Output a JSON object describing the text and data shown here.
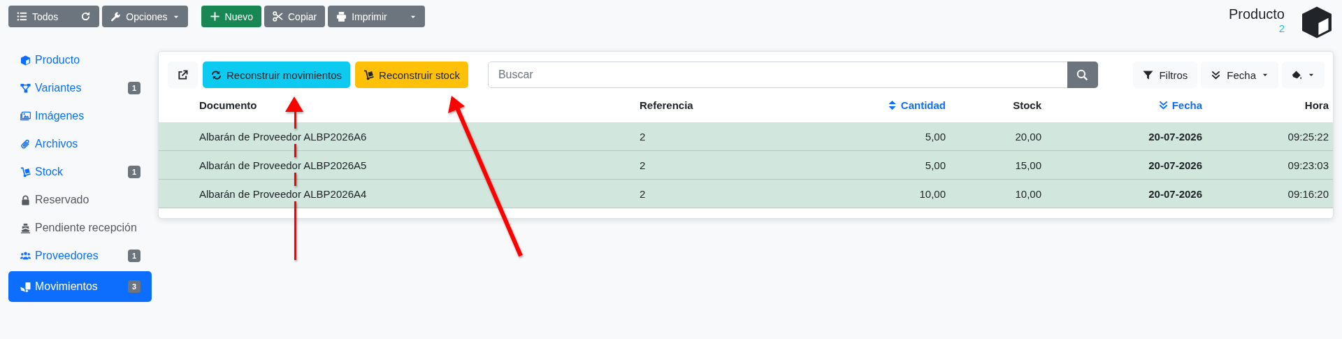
{
  "toolbar": {
    "groups": [
      {
        "buttons": [
          {
            "label": "Todos",
            "kind": "list"
          },
          {
            "label": "Opciones",
            "kind": "dropdown"
          }
        ]
      },
      {
        "buttons": [
          {
            "label": "Nuevo",
            "kind": "primary"
          },
          {
            "label": "Copiar",
            "kind": "plain"
          },
          {
            "label": "Imprimir",
            "kind": "split"
          }
        ]
      }
    ]
  },
  "header": {
    "title": "Producto",
    "count": "2"
  },
  "sidebar": {
    "items": [
      {
        "label": "Producto",
        "selected": false,
        "disabled": false
      },
      {
        "label": "Variantes",
        "badge": "1",
        "selected": false,
        "disabled": false
      },
      {
        "label": "Imágenes",
        "selected": false,
        "disabled": false
      },
      {
        "label": "Archivos",
        "selected": false,
        "disabled": false
      },
      {
        "label": "Stock",
        "badge": "1",
        "selected": false,
        "disabled": false
      },
      {
        "label": "Reservado",
        "selected": false,
        "disabled": true
      },
      {
        "label": "Pendiente recepción",
        "selected": false,
        "disabled": true
      },
      {
        "label": "Proveedores",
        "badge": "1",
        "selected": false,
        "disabled": false
      },
      {
        "label": "Movimientos",
        "badge": "3",
        "selected": true,
        "disabled": false
      }
    ]
  },
  "actions": [
    {
      "label": "Reconstruir movimientos",
      "kind": "info"
    },
    {
      "label": "Reconstruir stock",
      "kind": "warning"
    }
  ],
  "search": {
    "placeholder": "Buscar"
  },
  "filters": [
    {
      "label": "Filtros",
      "kind": "filter"
    },
    {
      "label": "Fecha",
      "kind": "sort"
    },
    {
      "kind": "color"
    }
  ],
  "table": {
    "columns": [
      {
        "label": "Documento",
        "kind": "plain"
      },
      {
        "label": "Referencia",
        "kind": "plain"
      },
      {
        "label": "Cantidad",
        "kind": "sortable"
      },
      {
        "label": "Stock",
        "kind": "plain"
      },
      {
        "label": "Fecha",
        "kind": "sorted"
      },
      {
        "label": "Hora",
        "kind": "plain"
      }
    ],
    "rows": [
      [
        "Albarán de Proveedor ALBP2026A6",
        "2",
        "5,00",
        "20,00",
        "20-07-2026",
        "09:25:22"
      ],
      [
        "Albarán de Proveedor ALBP2026A5",
        "2",
        "5,00",
        "15,00",
        "20-07-2026",
        "09:23:03"
      ],
      [
        "Albarán de Proveedor ALBP2026A4",
        "2",
        "10,00",
        "10,00",
        "20-07-2026",
        "09:16:20"
      ]
    ]
  }
}
